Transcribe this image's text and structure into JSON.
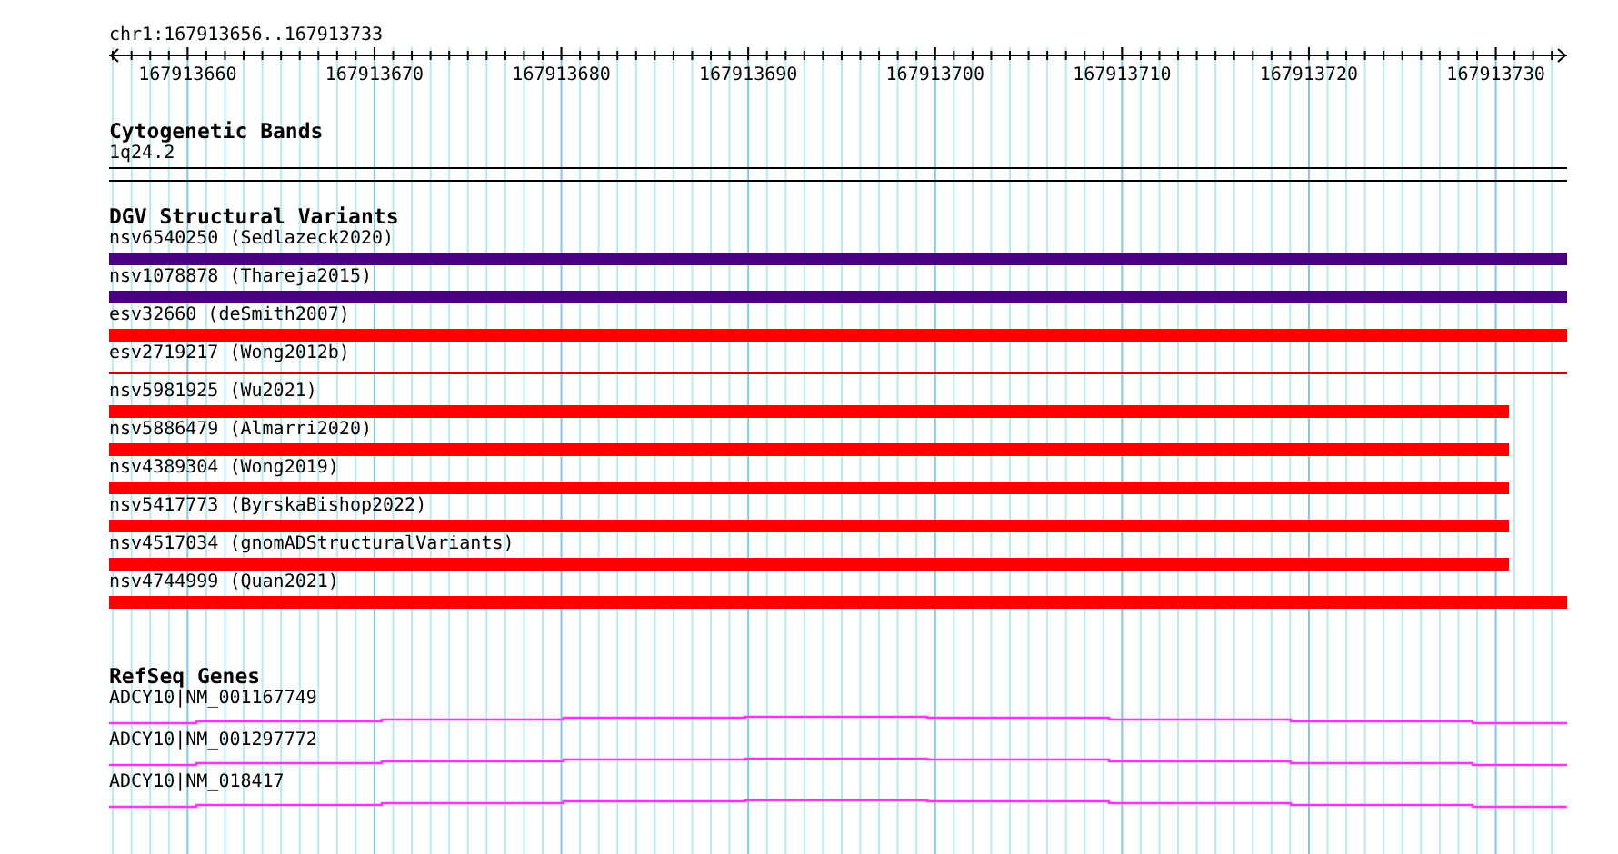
{
  "ruler": {
    "location": "chr1:167913656..167913733",
    "tick_labels": [
      "167913660",
      "167913670",
      "167913680",
      "167913690",
      "167913700",
      "167913710",
      "167913720",
      "167913730"
    ]
  },
  "tracks": [
    {
      "kind": "band",
      "title": "Cytogenetic Bands",
      "features": [
        {
          "label": "1q24.2"
        }
      ]
    },
    {
      "kind": "variant",
      "title": "DGV Structural Variants",
      "features": [
        {
          "label": "nsv6540250 (Sedlazeck2020)",
          "color": "#4b0082",
          "continues_right": true,
          "thin": false
        },
        {
          "label": "nsv1078878 (Thareja2015)",
          "color": "#4b0082",
          "continues_right": true,
          "thin": false
        },
        {
          "label": "esv32660 (deSmith2007)",
          "color": "#ff0000",
          "continues_right": true,
          "thin": false
        },
        {
          "label": "esv2719217 (Wong2012b)",
          "color": "#cc0000",
          "continues_right": true,
          "thin": true
        },
        {
          "label": "nsv5981925 (Wu2021)",
          "color": "#ff0000",
          "continues_right": false,
          "thin": false
        },
        {
          "label": "nsv5886479 (Almarri2020)",
          "color": "#ff0000",
          "continues_right": false,
          "thin": false
        },
        {
          "label": "nsv4389304 (Wong2019)",
          "color": "#ff0000",
          "continues_right": false,
          "thin": false
        },
        {
          "label": "nsv5417773 (ByrskaBishop2022)",
          "color": "#ff0000",
          "continues_right": false,
          "thin": false
        },
        {
          "label": "nsv4517034 (gnomADStructuralVariants)",
          "color": "#ff0000",
          "continues_right": false,
          "thin": false
        },
        {
          "label": "nsv4744999 (Quan2021)",
          "color": "#ff0000",
          "continues_right": true,
          "thin": false
        }
      ]
    },
    {
      "kind": "gene",
      "title": "RefSeq Genes",
      "features": [
        {
          "label": "ADCY10|NM_001167749"
        },
        {
          "label": "ADCY10|NM_001297772"
        },
        {
          "label": "ADCY10|NM_018417"
        }
      ]
    }
  ]
}
